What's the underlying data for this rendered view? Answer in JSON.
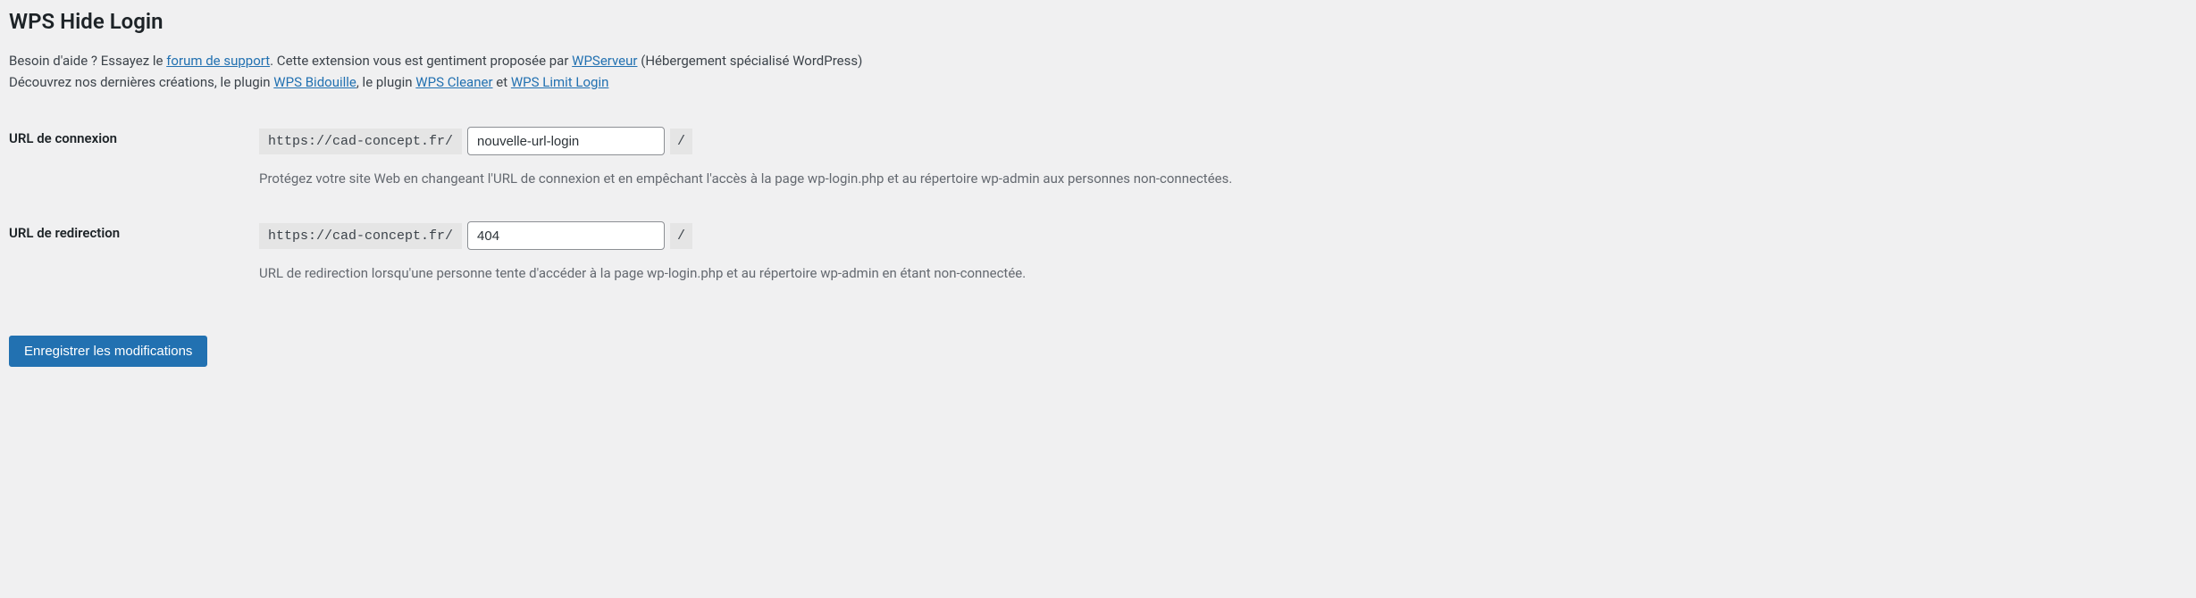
{
  "section": {
    "title": "WPS Hide Login"
  },
  "intro": {
    "help_prefix": "Besoin d'aide ? Essayez le ",
    "help_link": "forum de support",
    "proposed_by_prefix": ". Cette extension vous est gentiment proposée par ",
    "wpserveur_link": "WPServeur",
    "wpserveur_suffix": " (Hébergement spécialisé WordPress)",
    "discover_prefix": "Découvrez nos dernières créations, le plugin ",
    "wps_bidouille_link": "WPS Bidouille",
    "middle1": ", le plugin ",
    "wps_cleaner_link": "WPS Cleaner",
    "middle2": " et ",
    "wps_limit_login_link": "WPS Limit Login"
  },
  "fields": {
    "login_url": {
      "label": "URL de connexion",
      "prefix": "https://cad-concept.fr/",
      "value": "nouvelle-url-login",
      "suffix": "/",
      "description": "Protégez votre site Web en changeant l'URL de connexion et en empêchant l'accès à la page wp-login.php et au répertoire wp-admin aux personnes non-connectées."
    },
    "redirect_url": {
      "label": "URL de redirection",
      "prefix": "https://cad-concept.fr/",
      "value": "404",
      "suffix": "/",
      "description": "URL de redirection lorsqu'une personne tente d'accéder à la page wp-login.php et au répertoire wp-admin en étant non-connectée."
    }
  },
  "submit": {
    "label": "Enregistrer les modifications"
  }
}
